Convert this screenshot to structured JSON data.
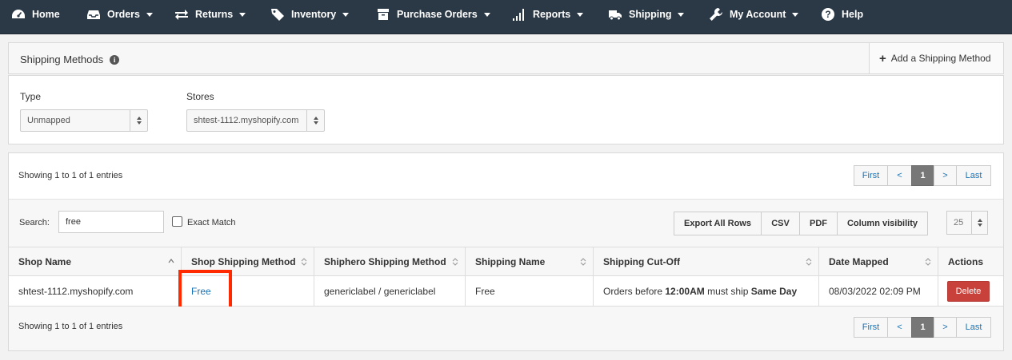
{
  "nav": {
    "items": [
      {
        "label": "Home",
        "icon": "dashboard-icon",
        "caret": false
      },
      {
        "label": "Orders",
        "icon": "inbox-icon",
        "caret": true
      },
      {
        "label": "Returns",
        "icon": "exchange-icon",
        "caret": true
      },
      {
        "label": "Inventory",
        "icon": "tag-icon",
        "caret": true
      },
      {
        "label": "Purchase Orders",
        "icon": "archive-icon",
        "caret": true
      },
      {
        "label": "Reports",
        "icon": "bar-chart-icon",
        "caret": true
      },
      {
        "label": "Shipping",
        "icon": "truck-icon",
        "caret": true
      },
      {
        "label": "My Account",
        "icon": "wrench-icon",
        "caret": true
      },
      {
        "label": "Help",
        "icon": "question-icon",
        "caret": false
      }
    ]
  },
  "header": {
    "title": "Shipping Methods",
    "info_icon": "i",
    "add_label": "Add a Shipping Method"
  },
  "filters": {
    "type_label": "Type",
    "type_value": "Unmapped",
    "stores_label": "Stores",
    "stores_value": "shtest-1112.myshopify.com"
  },
  "table": {
    "info_top": "Showing 1 to 1 of 1 entries",
    "info_bottom": "Showing 1 to 1 of 1 entries",
    "pager": {
      "first": "First",
      "prev": "<",
      "current": "1",
      "next": ">",
      "last": "Last"
    },
    "search_label": "Search:",
    "search_value": "free",
    "exact_match_label": "Exact Match",
    "buttons": {
      "export": "Export All Rows",
      "csv": "CSV",
      "pdf": "PDF",
      "colvis": "Column visibility"
    },
    "page_size": "25",
    "columns": [
      "Shop Name",
      "Shop Shipping Method",
      "Shiphero Shipping Method",
      "Shipping Name",
      "Shipping Cut-Off",
      "Date Mapped",
      "Actions"
    ],
    "row": {
      "shop_name": "shtest-1112.myshopify.com",
      "shop_method": "Free",
      "shiphero_method": "genericlabel / genericlabel",
      "shipping_name": "Free",
      "cutoff_prefix": "Orders before ",
      "cutoff_time": "12:00AM",
      "cutoff_mid": " must ship ",
      "cutoff_day": "Same Day",
      "date_mapped": "08/03/2022 02:09 PM",
      "action": "Delete"
    }
  },
  "colors": {
    "nav_bg": "#2b3846",
    "link": "#1a73b5",
    "danger": "#c9413b",
    "highlight": "#ff2a00"
  }
}
